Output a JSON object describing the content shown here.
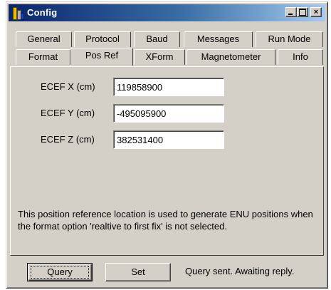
{
  "window": {
    "title": "Config"
  },
  "titlebar_buttons": {
    "minimize": "_",
    "maximize": "□",
    "close": "×"
  },
  "tabs_row1": [
    "General",
    "Protocol",
    "Baud",
    "Messages",
    "Run Mode"
  ],
  "tabs_row2": [
    "Format",
    "Pos Ref",
    "XForm",
    "Magnetometer",
    "Info"
  ],
  "active_tab": "Pos Ref",
  "fields": [
    {
      "label": "ECEF X (cm)",
      "value": "119858900"
    },
    {
      "label": "ECEF Y (cm)",
      "value": "-495095900"
    },
    {
      "label": "ECEF Z (cm)",
      "value": "382531400"
    }
  ],
  "note": "This position reference location is used to generate ENU positions when the format option 'realtive to first fix' is not selected.",
  "buttons": {
    "query": "Query",
    "set": "Set"
  },
  "status": "Query sent. Awaiting reply."
}
